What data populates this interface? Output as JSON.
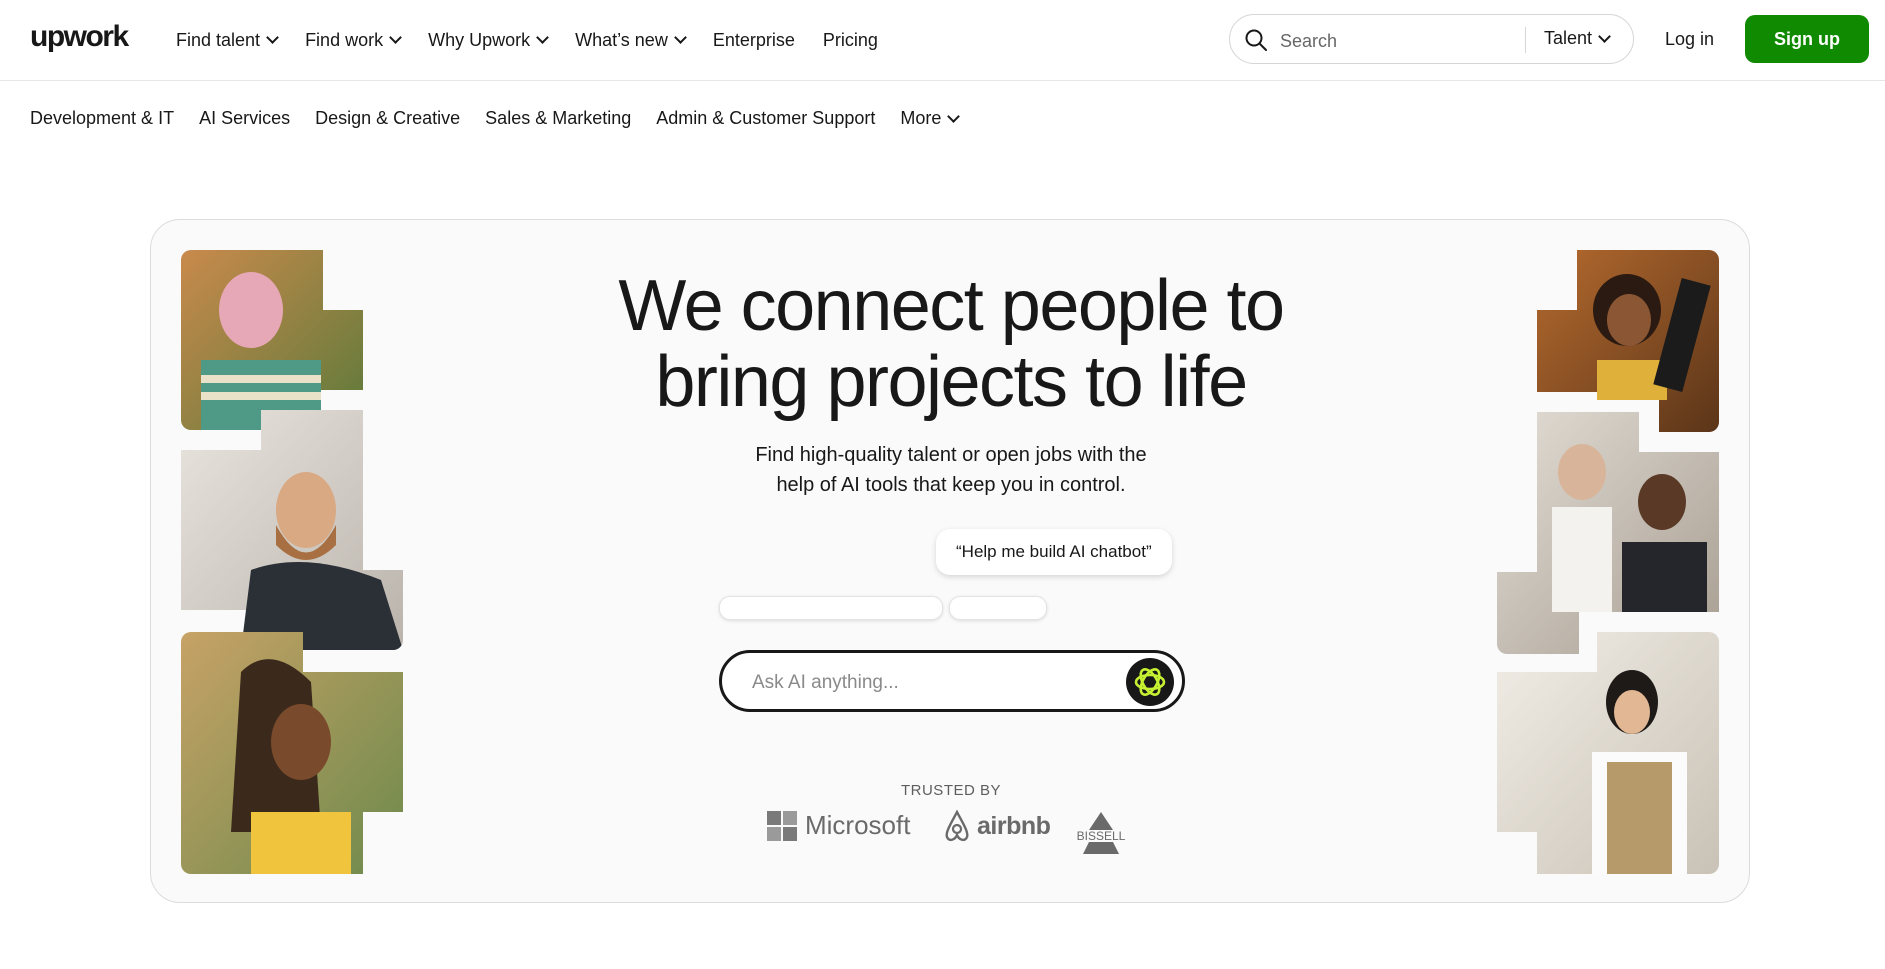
{
  "brand": {
    "logo_text": "upwork",
    "accent_color": "#108a00"
  },
  "top_nav": {
    "items": [
      {
        "label": "Find talent",
        "has_dropdown": true
      },
      {
        "label": "Find work",
        "has_dropdown": true
      },
      {
        "label": "Why Upwork",
        "has_dropdown": true
      },
      {
        "label": "What’s new",
        "has_dropdown": true
      },
      {
        "label": "Enterprise",
        "has_dropdown": false
      },
      {
        "label": "Pricing",
        "has_dropdown": false
      }
    ],
    "search": {
      "placeholder": "Search",
      "scope": "Talent",
      "icon": "search-icon"
    },
    "login_label": "Log in",
    "signup_label": "Sign up"
  },
  "category_nav": {
    "items": [
      "Development & IT",
      "AI Services",
      "Design & Creative",
      "Sales & Marketing",
      "Admin & Customer Support"
    ],
    "more_label": "More"
  },
  "hero": {
    "headline_line1": "We connect people to",
    "headline_line2": "bring projects to life",
    "sub_line1": "Find high-quality talent or open jobs with the",
    "sub_line2": "help of AI tools that keep you in control.",
    "suggestion_chip": "“Help me build AI chatbot”",
    "ai_placeholder": "Ask AI anything...",
    "trusted_by_label": "TRUSTED BY",
    "trusted_logos": [
      "Microsoft",
      "airbnb",
      "BISSELL"
    ]
  }
}
